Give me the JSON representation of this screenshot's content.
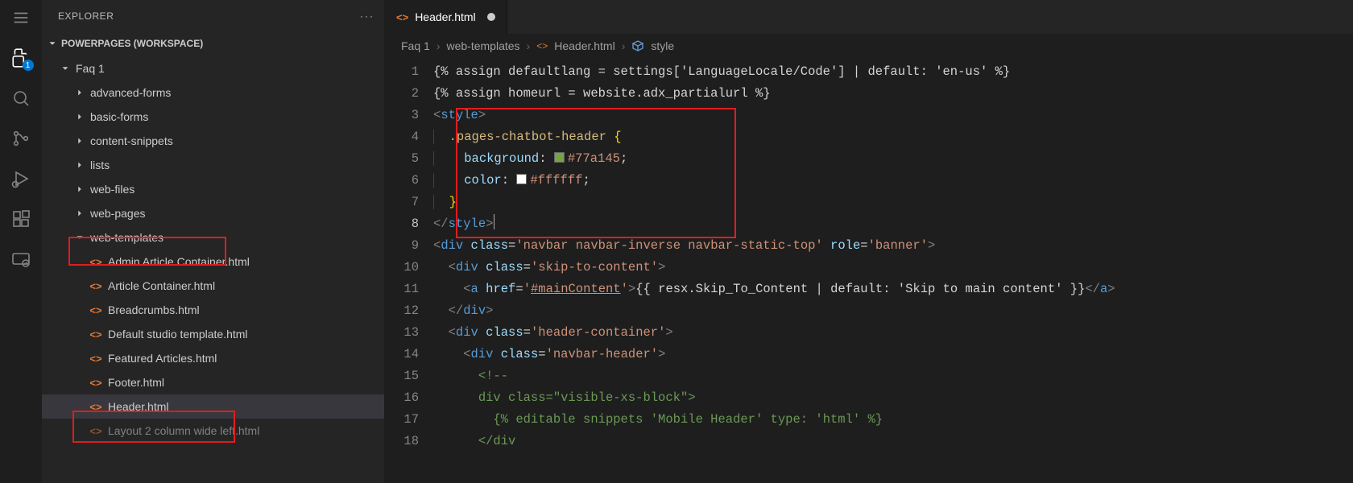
{
  "activity": {
    "explorer_badge": "1"
  },
  "sidebar": {
    "title": "EXPLORER",
    "workspace": "POWERPAGES (WORKSPACE)",
    "rootFolder": "Faq 1",
    "folders": [
      "advanced-forms",
      "basic-forms",
      "content-snippets",
      "lists",
      "web-files",
      "web-pages"
    ],
    "expandedFolder": "web-templates",
    "files": [
      "Admin Article Container.html",
      "Article Container.html",
      "Breadcrumbs.html",
      "Default studio template.html",
      "Featured Articles.html",
      "Footer.html",
      "Header.html",
      "Layout 2 column wide left.html"
    ],
    "activeFile": "Header.html"
  },
  "tab": {
    "label": "Header.html"
  },
  "breadcrumbs": {
    "items": [
      "Faq 1",
      "web-templates",
      "Header.html",
      "style"
    ]
  },
  "code": {
    "currentLine": 8,
    "lines": [
      "{% assign defaultlang = settings['LanguageLocale/Code'] | default: 'en-us' %}",
      "{% assign homeurl = website.adx_partialurl %}",
      "<style>",
      "  .pages-chatbot-header {",
      "    background: #77a145;",
      "    color: #ffffff;",
      "  }",
      "</style>",
      "<div class='navbar navbar-inverse navbar-static-top' role='banner'>",
      "  <div class='skip-to-content'>",
      "    <a href='#mainContent'>{{ resx.Skip_To_Content | default: 'Skip to main content' }}</a>",
      "  </div>",
      "  <div class='header-container'>",
      "    <div class='navbar-header'>",
      "      <!--",
      "      div class=\"visible-xs-block\">",
      "        {% editable snippets 'Mobile Header' type: 'html' %}",
      "      </div"
    ],
    "swatches": {
      "bg": "#77a145",
      "fg": "#ffffff"
    }
  }
}
